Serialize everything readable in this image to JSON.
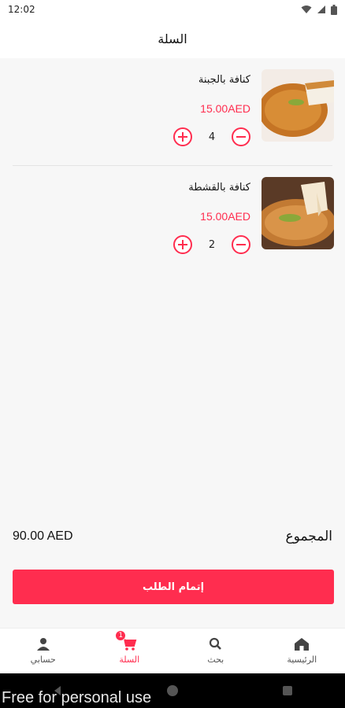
{
  "status_bar": {
    "time": "12:02"
  },
  "header": {
    "title": "السلة"
  },
  "cart": {
    "items": [
      {
        "name": "كنافة بالجبنة",
        "price": "15.00AED",
        "quantity": "4",
        "image": "kunafa-cheese"
      },
      {
        "name": "كنافة بالقشطة",
        "price": "15.00AED",
        "quantity": "2",
        "image": "kunafa-cream"
      }
    ]
  },
  "summary": {
    "total_label": "المجموع",
    "total_value": "90.00 AED"
  },
  "checkout": {
    "label": "إتمام الطلب"
  },
  "bottom_nav": {
    "items": [
      {
        "label": "الرئيسية",
        "icon": "home-icon"
      },
      {
        "label": "بحث",
        "icon": "search-icon"
      },
      {
        "label": "السلة",
        "icon": "cart-icon",
        "badge": "1"
      },
      {
        "label": "حسابي",
        "icon": "user-icon"
      }
    ]
  },
  "watermark": {
    "text": "Free for personal use"
  },
  "colors": {
    "accent": "#ff2d4f",
    "background": "#f7f7f7"
  }
}
